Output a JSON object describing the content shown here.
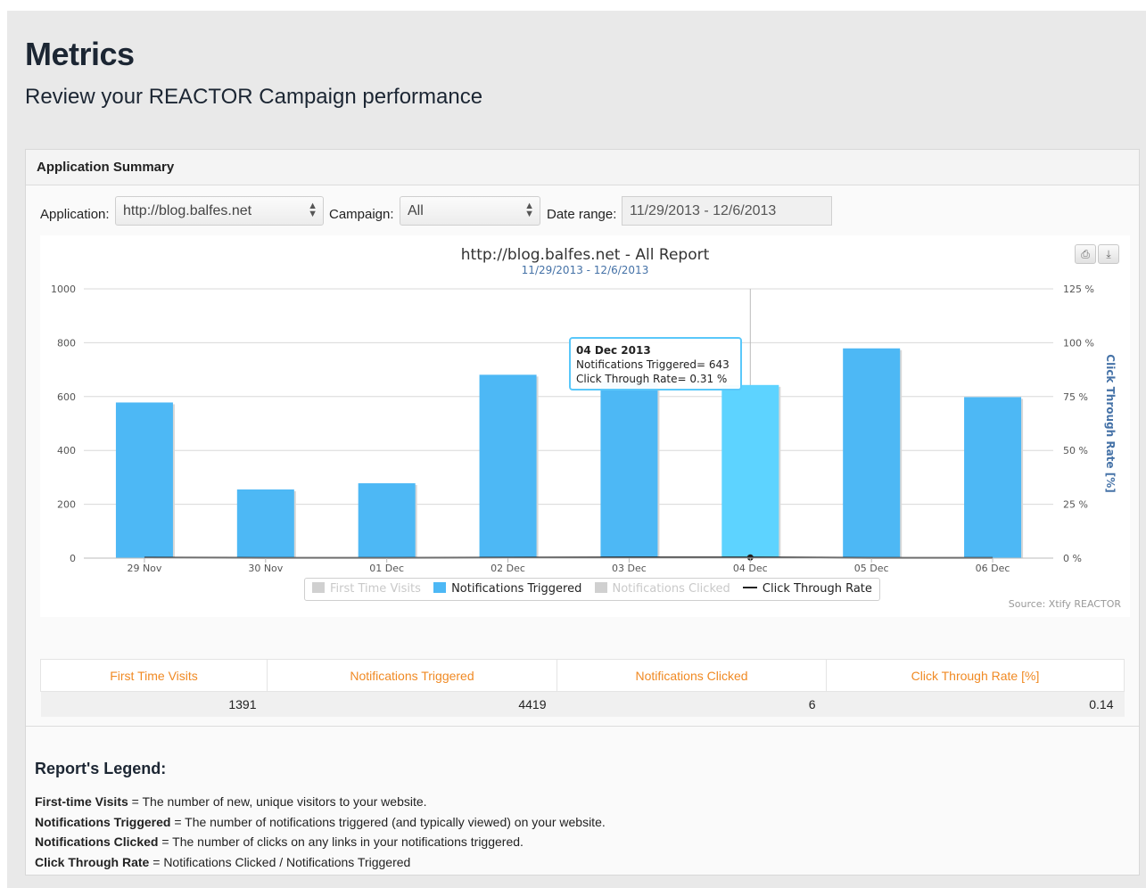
{
  "page": {
    "title": "Metrics",
    "subtitle": "Review your REACTOR Campaign performance"
  },
  "panel": {
    "header": "Application Summary"
  },
  "filters": {
    "application_label": "Application:",
    "application_value": "http://blog.balfes.net",
    "campaign_label": "Campaign:",
    "campaign_value": "All",
    "date_label": "Date range:",
    "date_value": "11/29/2013 - 12/6/2013"
  },
  "chart_data": {
    "type": "bar",
    "title": "http://blog.balfes.net - All Report",
    "subtitle": "11/29/2013 - 12/6/2013",
    "categories": [
      "29 Nov",
      "30 Nov",
      "01 Dec",
      "02 Dec",
      "03 Dec",
      "04 Dec",
      "05 Dec",
      "06 Dec"
    ],
    "series": [
      {
        "name": "First Time Visits",
        "visible": false,
        "values": []
      },
      {
        "name": "Notifications Triggered",
        "values": [
          578,
          255,
          278,
          681,
          657,
          643,
          779,
          598
        ],
        "color": "#4db8f5"
      },
      {
        "name": "Notifications Clicked",
        "visible": false,
        "values": []
      },
      {
        "name": "Click Through Rate",
        "type": "line",
        "values": [
          0.2,
          0.1,
          0.1,
          0.2,
          0.3,
          0.31,
          0.1,
          0.1
        ],
        "color": "#222222"
      }
    ],
    "y_left": {
      "ticks": [
        "0",
        "200",
        "400",
        "600",
        "800",
        "1000"
      ],
      "ylim": [
        0,
        1000
      ]
    },
    "y_right": {
      "label": "Click Through Rate [%]",
      "ticks": [
        "0 %",
        "25 %",
        "50 %",
        "75 %",
        "100 %",
        "125 %"
      ],
      "ylim": [
        0,
        125
      ]
    },
    "highlight_index": 5,
    "highlight_color": "#5dd3ff",
    "grid": true,
    "legend_position": "bottom-center",
    "tooltip": {
      "date": "04 Dec 2013",
      "line1": "Notifications Triggered= 643",
      "line2": "Click Through Rate= 0.31 %"
    },
    "source": "Source: Xtify REACTOR"
  },
  "legend_labels": {
    "first_time_visits": "First Time Visits",
    "notifications_triggered": "Notifications Triggered",
    "notifications_clicked": "Notifications Clicked",
    "click_through_rate": "Click Through Rate"
  },
  "stats": {
    "headers": [
      "First Time Visits",
      "Notifications Triggered",
      "Notifications Clicked",
      "Click Through Rate [%]"
    ],
    "values": [
      "1391",
      "4419",
      "6",
      "0.14"
    ]
  },
  "report_legend": {
    "title": "Report's Legend:",
    "items": [
      {
        "term": "First-time Visits",
        "desc": " = The number of new, unique visitors to your website."
      },
      {
        "term": "Notifications Triggered",
        "desc": " = The number of notifications triggered (and typically viewed) on your website."
      },
      {
        "term": "Notifications Clicked",
        "desc": " = The number of clicks on any links in your notifications triggered."
      },
      {
        "term": "Click Through Rate",
        "desc": " = Notifications Clicked / Notifications Triggered"
      }
    ]
  },
  "colors": {
    "accent_orange": "#f08a24",
    "bar_blue": "#4db8f5"
  }
}
